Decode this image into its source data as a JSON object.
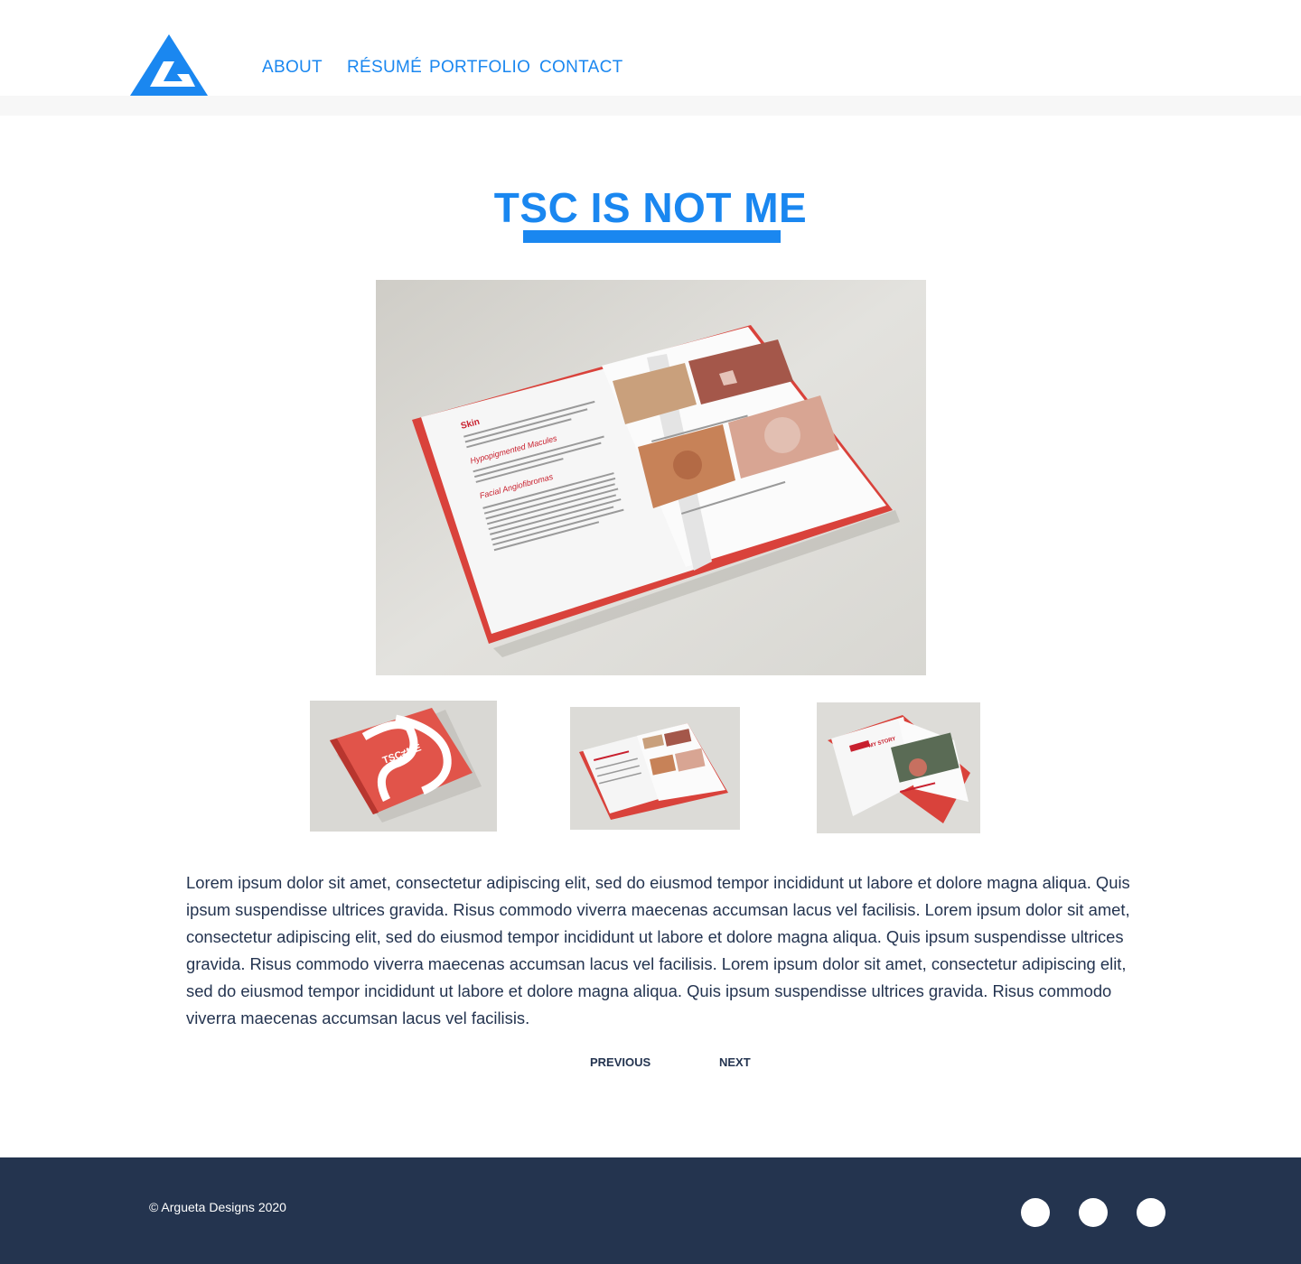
{
  "nav": {
    "items": [
      {
        "label": "ABOUT"
      },
      {
        "label": "RÉSUMÉ"
      },
      {
        "label": "PORTFOLIO"
      },
      {
        "label": "CONTACT"
      }
    ]
  },
  "project": {
    "title": "TSC IS NOT ME",
    "description": "Lorem ipsum dolor sit amet, consectetur adipiscing elit, sed do eiusmod tempor incididunt ut labore et dolore magna aliqua. Quis ipsum suspendisse ultrices gravida. Risus commodo viverra maecenas accumsan lacus vel facilisis. Lorem ipsum dolor sit amet, consectetur adipiscing elit, sed do eiusmod tempor incididunt ut labore et dolore magna aliqua. Quis ipsum suspendisse ultrices gravida. Risus commodo viverra maecenas accumsan lacus vel facilisis. Lorem ipsum dolor sit amet, consectetur adipiscing elit, sed do eiusmod tempor incididunt ut labore et dolore magna aliqua. Quis ipsum suspendisse ultrices gravida. Risus commodo viverra maecenas accumsan lacus vel facilisis.",
    "hero_page_text": {
      "heading": "Skin",
      "sub1": "Hypopigmented Macules",
      "sub2": "Facial Angiofibromas"
    },
    "cover_text": "TSC≠ME",
    "story_text": "MY STORY"
  },
  "pager": {
    "previous": "PREVIOUS",
    "next": "NEXT"
  },
  "footer": {
    "copyright": "© Argueta Designs 2020",
    "social": [
      "social-icon-1",
      "social-icon-2",
      "social-icon-3"
    ]
  },
  "colors": {
    "accent": "#1a87f0",
    "footer_bg": "#24344f",
    "text": "#243450",
    "book_red": "#e0443d"
  }
}
